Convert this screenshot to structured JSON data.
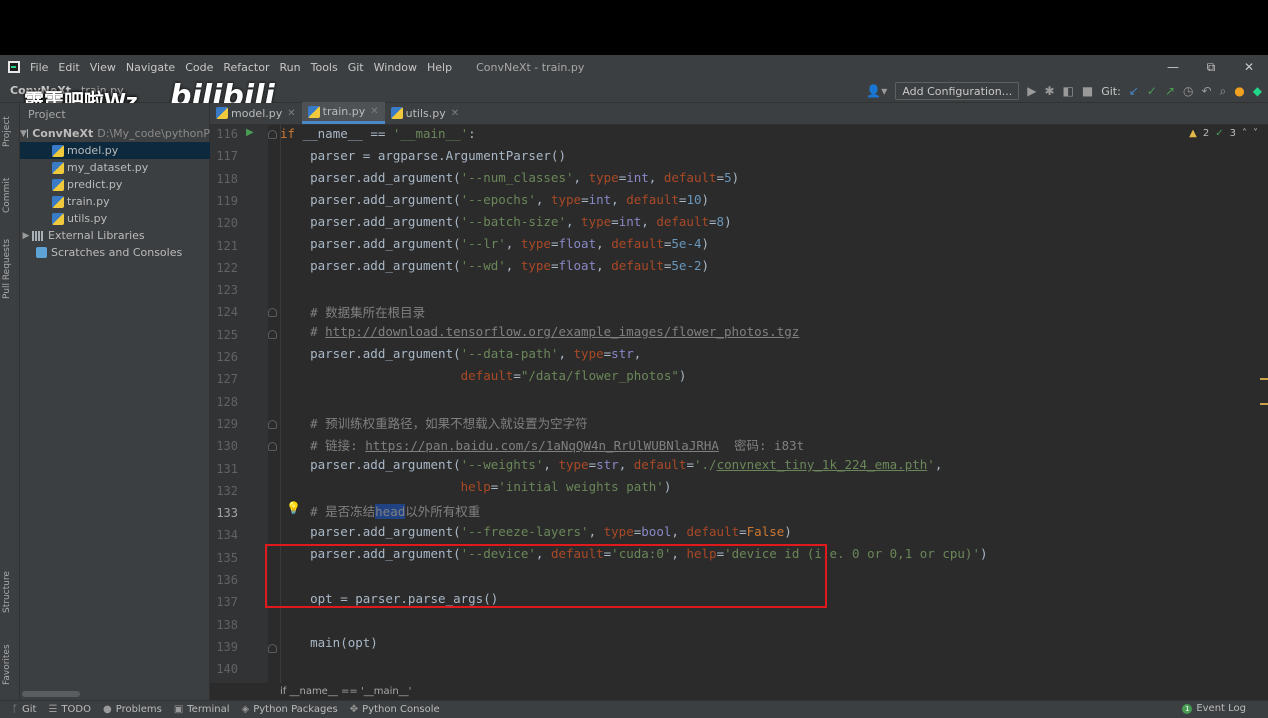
{
  "watermark": {
    "text": "霹雳吧啦Wz",
    "logo": "bilibili"
  },
  "menubar": {
    "items": [
      "File",
      "Edit",
      "View",
      "Navigate",
      "Code",
      "Refactor",
      "Run",
      "Tools",
      "Git",
      "Window",
      "Help"
    ],
    "window_title": "ConvNeXt - train.py",
    "controls": {
      "minimize": "—",
      "maximize": "⧉",
      "close": "✕"
    }
  },
  "navbar": {
    "project": "ConvNeXt",
    "file": "train.py",
    "add_configuration": "Add Configuration...",
    "git_label": "Git:"
  },
  "left_strip": {
    "tabs": [
      "Project",
      "Commit",
      "Pull Requests",
      "Structure",
      "Favorites"
    ]
  },
  "project_panel": {
    "header": "Project",
    "root": {
      "name": "ConvNeXt",
      "path": "D:\\My_code\\pythonP"
    },
    "files": [
      "model.py",
      "my_dataset.py",
      "predict.py",
      "train.py",
      "utils.py"
    ],
    "selected_file": "model.py",
    "external_libraries": "External Libraries",
    "scratches": "Scratches and Consoles"
  },
  "tabs": [
    {
      "label": "model.py",
      "active": false
    },
    {
      "label": "train.py",
      "active": true
    },
    {
      "label": "utils.py",
      "active": false
    }
  ],
  "editor": {
    "inspections": {
      "warnings": "2",
      "weak": "3"
    },
    "line_numbers": [
      "116",
      "117",
      "118",
      "119",
      "120",
      "121",
      "122",
      "123",
      "124",
      "125",
      "126",
      "127",
      "128",
      "129",
      "130",
      "131",
      "132",
      "133",
      "134",
      "135",
      "136",
      "137",
      "138",
      "139",
      "140"
    ],
    "current_line": "133",
    "breadcrumb": "if __name__ == '__main__'",
    "code": {
      "l116_kw": "if",
      "l116_rest": " __name__ == ",
      "l116_str": "'__main__'",
      "l116_end": ":",
      "l117": "    parser = argparse.ArgumentParser()",
      "l124_cmt": "    # 数据集所在根目录",
      "l125_cmt": "    # ",
      "l125_link": "http://download.tensorflow.org/example_images/flower_photos.tgz",
      "l129_cmt": "    # 预训练权重路径，如果不想载入就设置为空字符",
      "l130_cmt": "    # 链接: ",
      "l130_link": "https://pan.baidu.com/s/1aNqQW4n_RrUlWUBNlaJRHA",
      "l130_tail": "  密码: i83t",
      "l133_a": "    # 是否冻结",
      "l133_sel": "head",
      "l133_b": "以外所有权重",
      "l137": "    opt = parser.parse_args()",
      "l139": "    main(opt)"
    },
    "args": [
      {
        "flag": "'--num_classes'",
        "type": "int",
        "default": "5"
      },
      {
        "flag": "'--epochs'",
        "type": "int",
        "default": "10"
      },
      {
        "flag": "'--batch-size'",
        "type": "int",
        "default": "8"
      },
      {
        "flag": "'--lr'",
        "type": "float",
        "default": "5e-4"
      },
      {
        "flag": "'--wd'",
        "type": "float",
        "default": "5e-2"
      }
    ],
    "data_path": {
      "flag": "'--data-path'",
      "type": "str",
      "default": "\"/data/flower_photos\""
    },
    "weights": {
      "flag": "'--weights'",
      "type": "str",
      "default_pre": "'./",
      "default_link": "convnext_tiny_1k_224_ema.pth",
      "default_post": "'",
      "help": "'initial weights path'"
    },
    "freeze": {
      "flag": "'--freeze-layers'",
      "type": "bool",
      "default": "False"
    },
    "device": {
      "flag": "'--device'",
      "default": "'cuda:0'",
      "help": "'device id (i.e. 0 or 0,1 or cpu)'"
    }
  },
  "bottombar": {
    "items": [
      "Git",
      "TODO",
      "Problems",
      "Terminal",
      "Python Packages",
      "Python Console"
    ],
    "event_log": "Event Log",
    "event_count": "1"
  }
}
